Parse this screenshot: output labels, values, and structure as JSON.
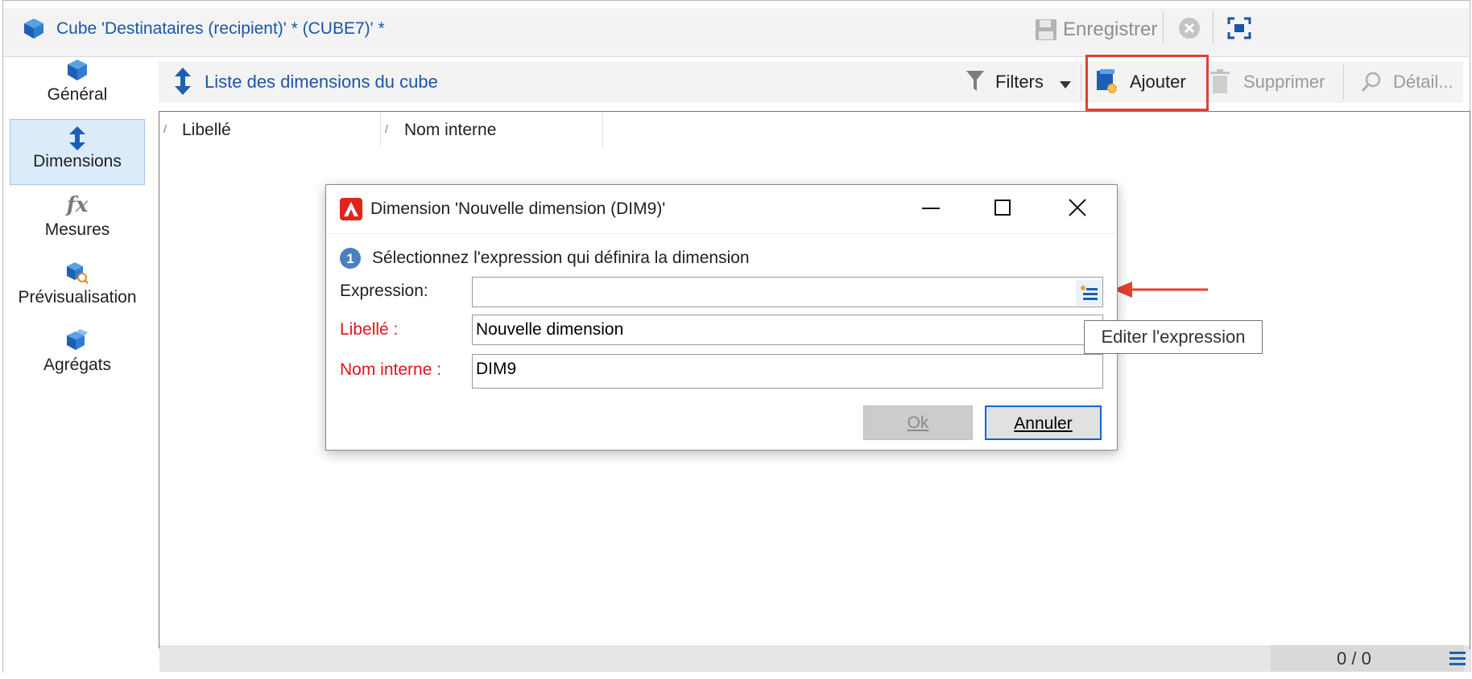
{
  "window": {
    "title": "Cube 'Destinataires (recipient)' * (CUBE7)' *",
    "save_label": "Enregistrer"
  },
  "sidebar": {
    "items": [
      {
        "label": "Général",
        "icon": "cube-icon"
      },
      {
        "label": "Dimensions",
        "icon": "up-down-arrow-icon"
      },
      {
        "label": "Mesures",
        "icon": "fx-icon",
        "glyph": "fx"
      },
      {
        "label": "Prévisualisation",
        "icon": "preview-icon"
      },
      {
        "label": "Agrégats",
        "icon": "aggregates-icon"
      }
    ]
  },
  "toolbar": {
    "list_title": "Liste des dimensions du cube",
    "filters_label": "Filters",
    "add_label": "Ajouter",
    "delete_label": "Supprimer",
    "detail_label": "Détail..."
  },
  "grid": {
    "columns": [
      "Libellé",
      "Nom interne"
    ],
    "counter": "0 / 0"
  },
  "dialog": {
    "title": "Dimension 'Nouvelle dimension (DIM9)'",
    "step_number": "1",
    "step_text": "Sélectionnez l'expression qui définira la dimension",
    "expression_label": "Expression:",
    "expression_value": "",
    "libelle_label": "Libellé :",
    "libelle_value": "Nouvelle dimension",
    "nom_label": "Nom interne :",
    "nom_value": "DIM9",
    "ok_label": "Ok",
    "cancel_label": "Annuler",
    "tooltip": "Editer l'expression"
  },
  "colors": {
    "accent": "#1a56a8",
    "highlight": "#e2402f",
    "required": "#e0141e",
    "selection": "#dcebfa"
  }
}
